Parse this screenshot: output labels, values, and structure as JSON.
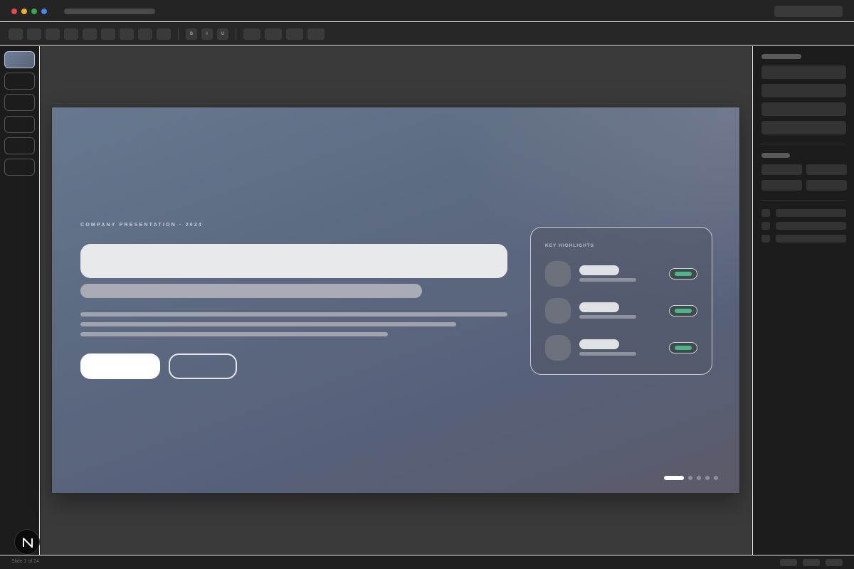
{
  "window": {
    "traffic_lights": {
      "close": "#e5484d",
      "minimize": "#e6b12a",
      "maximize": "#34a853",
      "extra": "#4a86e8"
    }
  },
  "toolbar": {
    "format_buttons": [
      "B",
      "I",
      "U"
    ]
  },
  "sidebar": {
    "slide_thumbnails_visible": 6,
    "active_index": 0
  },
  "slide": {
    "eyebrow": "COMPANY PRESENTATION · 2024",
    "highlights": {
      "title": "KEY HIGHLIGHTS",
      "items_count": 3,
      "badge_color": "#4fb58c"
    },
    "pagination": {
      "total_dots": 5,
      "active_index": 0
    }
  },
  "statusbar": {
    "slide_info": "Slide 1 of 24"
  },
  "badge": {
    "icon": "n-logo-icon"
  }
}
